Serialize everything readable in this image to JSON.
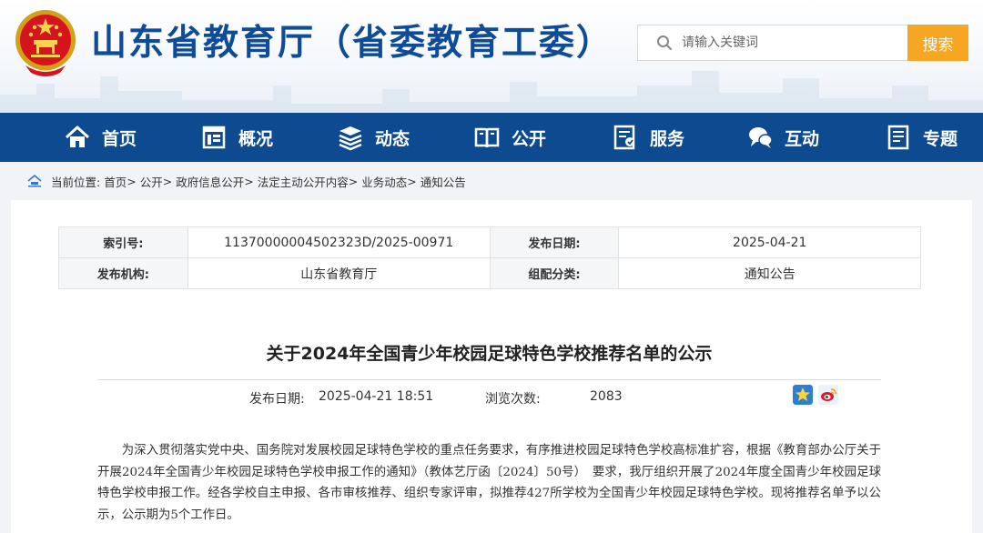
{
  "header": {
    "site_title": "山东省教育厅（省委教育工委）",
    "search_placeholder": "请输入关键词",
    "search_button": "搜索"
  },
  "nav": {
    "items": [
      {
        "label": "首页",
        "icon": "home-icon"
      },
      {
        "label": "概况",
        "icon": "overview-icon"
      },
      {
        "label": "动态",
        "icon": "news-stack-icon"
      },
      {
        "label": "公开",
        "icon": "open-book-icon"
      },
      {
        "label": "服务",
        "icon": "service-icon"
      },
      {
        "label": "互动",
        "icon": "chat-icon"
      },
      {
        "label": "专题",
        "icon": "topic-icon"
      }
    ]
  },
  "breadcrumb": {
    "prefix": "当前位置:",
    "items": [
      "首页",
      "公开",
      "政府信息公开",
      "法定主动公开内容",
      "业务动态",
      "通知公告"
    ],
    "separator": ">"
  },
  "meta": {
    "index_label": "索引号:",
    "index_value": "11370000004502323D/2025-00971",
    "date_label": "发布日期:",
    "date_value": "2025-04-21",
    "org_label": "发布机构:",
    "org_value": "山东省教育厅",
    "category_label": "组配分类:",
    "category_value": "通知公告"
  },
  "article": {
    "title": "关于2024年全国青少年校园足球特色学校推荐名单的公示",
    "publish_label": "发布日期:",
    "publish_value": "2025-04-21 18:51",
    "views_label": "浏览次数:",
    "views_value": "2083",
    "share_icons": [
      "favorite-star-icon",
      "weibo-icon"
    ],
    "paragraph": "为深入贯彻落实党中央、国务院对发展校园足球特色学校的重点任务要求，有序推进校园足球特色学校高标准扩容，根据《教育部办公厅关于开展2024年全国青少年校园足球特色学校申报工作的通知》（教体艺厅函〔2024〕50号）　要求，我厅组织开展了2024年度全国青少年校园足球特色学校申报工作。经各学校自主申报、各市审核推荐、组织专家评审，拟推荐427所学校为全国青少年校园足球特色学校。现将推荐名单予以公示，公示期为5个工作日。"
  },
  "colors": {
    "brand_blue": "#0e4a8f",
    "title_blue": "#0f4c97",
    "search_orange": "#f5a623"
  }
}
